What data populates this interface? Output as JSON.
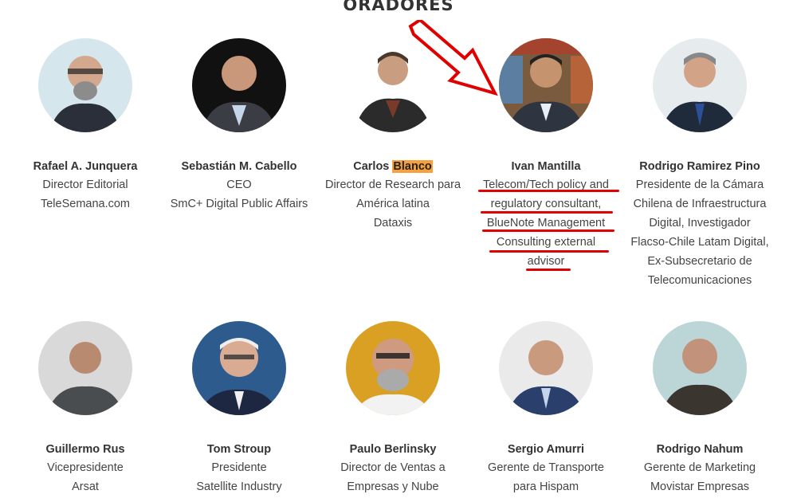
{
  "section": {
    "title": "ORADORES"
  },
  "speakers_row1": [
    {
      "name": "Rafael A. Junquera",
      "role": "Director Editorial\nTeleSemana.com"
    },
    {
      "name": "Sebastián M. Cabello",
      "role": "CEO\nSmC+ Digital Public Affairs"
    },
    {
      "name_pre": "Carlos ",
      "name_hl": "Blanco",
      "role": "Director de Research para\nAmérica latina\nDataxis"
    },
    {
      "name": "Ivan Mantilla",
      "role": "Telecom/Tech policy and\nregulatory consultant,\nBlueNote Management\nConsulting external\nadvisor"
    },
    {
      "name": "Rodrigo Ramirez Pino",
      "role": "Presidente de la Cámara\nChilena de Infraestructura\nDigital, Investigador\nFlacso-Chile Latam Digital,\nEx-Subsecretario de\nTelecomunicaciones"
    }
  ],
  "speakers_row2": [
    {
      "name": "Guillermo Rus",
      "role": "Vicepresidente\nArsat"
    },
    {
      "name": "Tom Stroup",
      "role": "Presidente\nSatellite Industry"
    },
    {
      "name": "Paulo Berlinsky",
      "role": "Director de Ventas a\nEmpresas y Nube"
    },
    {
      "name": "Sergio Amurri",
      "role": "Gerente de Transporte\npara Hispam"
    },
    {
      "name": "Rodrigo Nahum",
      "role": "Gerente de Marketing\nMovistar Empresas"
    }
  ],
  "colors": {
    "highlight": "#f7a13c",
    "annotation": "#e00000"
  }
}
